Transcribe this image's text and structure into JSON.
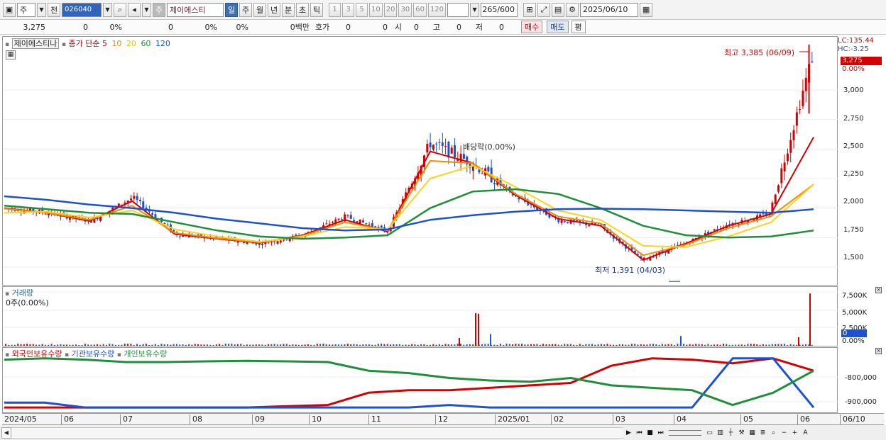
{
  "toolbar": {
    "market_type": "주",
    "prev_label": "전",
    "stock_code": "026040",
    "stock_badge": "주",
    "stock_name": "제이에스티",
    "periods": [
      "일",
      "주",
      "월",
      "년",
      "분",
      "초",
      "틱"
    ],
    "active_period": "일",
    "intervals": [
      "1",
      "3",
      "5",
      "10",
      "20",
      "30",
      "60",
      "120"
    ],
    "bar_count": "265",
    "bar_total": "/600",
    "date": "2025/06/10"
  },
  "quote": {
    "price": "3,275",
    "change": "0",
    "change_pct": "0%",
    "volume": "0",
    "volume_pct": "0%",
    "volume_pct2": "0%",
    "amount": "0백만",
    "hoga_label": "호가",
    "hoga_bid": "0",
    "hoga_ask": "0",
    "open_label": "시",
    "open_value": "0",
    "high_label": "고",
    "high_value": "0",
    "low_label": "저",
    "low_value": "0",
    "buy_label": "매수",
    "sell_label": "매도",
    "eval_label": "평"
  },
  "price_pane": {
    "stock_label": "제이에스티나",
    "ma_legend_title": "종가 단순",
    "ma_periods": [
      {
        "period": "5",
        "color": "#d40000"
      },
      {
        "period": "10",
        "color": "#f08c00"
      },
      {
        "period": "20",
        "color": "#ffd21a"
      },
      {
        "period": "60",
        "color": "#1f8f3a"
      },
      {
        "period": "120",
        "color": "#1e50d2"
      }
    ],
    "lc_label": "LC:135.44",
    "hc_label": "HC:-3.25",
    "current_price_tag": "3,275",
    "current_pct_tag": "0.00%",
    "y_ticks": [
      "3,000",
      "2,750",
      "2,500",
      "2,250",
      "2,000",
      "1,750",
      "1,500"
    ],
    "high_annotation": "최고 3,385 (06/09)",
    "low_annotation": "최저 1,391 (04/03)",
    "dividend_annotation": "배당락(0.00%)"
  },
  "volume_pane": {
    "title": "거래량",
    "subtitle": "0주(0.00%)",
    "y_ticks": [
      "7,500K",
      "5,000K",
      "2,500K"
    ],
    "current_tag": "0",
    "pct_tag": "0.00%"
  },
  "holdings_pane": {
    "series": [
      {
        "name": "외국인보유수량",
        "color": "#d40000"
      },
      {
        "name": "기관보유수량",
        "color": "#1e50d2"
      },
      {
        "name": "개인보유수량",
        "color": "#1f8f3a"
      }
    ],
    "y_ticks": [
      "-800,000",
      "-900,000"
    ]
  },
  "x_axis": {
    "labels": [
      "2024/05",
      "06",
      "07",
      "08",
      "09",
      "10",
      "11",
      "12",
      "2025/01",
      "02",
      "03",
      "04",
      "05",
      "06"
    ],
    "right_label": "06/10"
  },
  "colors": {
    "up": "#d40000",
    "down": "#1e50d2",
    "ma5": "#d40000",
    "ma10": "#f08c00",
    "ma20": "#ffd21a",
    "ma60": "#1f8f3a",
    "ma120": "#1e50d2",
    "accent": "#3265b8"
  },
  "chart_data": [
    {
      "type": "candlestick",
      "title": "제이에스티나",
      "y_axis": {
        "min": 1350,
        "max": 3450,
        "ticks": [
          3000,
          2750,
          2500,
          2250,
          2000,
          1750,
          1500
        ]
      },
      "x_categories": [
        "2024/05",
        "06",
        "07",
        "08",
        "09",
        "10",
        "11",
        "12",
        "2025/01",
        "02",
        "03",
        "04",
        "05",
        "06"
      ],
      "close_path": [
        [
          "2024/05",
          2000
        ],
        [
          "06",
          1960
        ],
        [
          "07",
          1890
        ],
        [
          "07b",
          2090
        ],
        [
          "08",
          1780
        ],
        [
          "09",
          1740
        ],
        [
          "10",
          1700
        ],
        [
          "11",
          1770
        ],
        [
          "11b",
          1930
        ],
        [
          "12",
          1800
        ],
        [
          "12b",
          2550
        ],
        [
          "2025/01",
          2380
        ],
        [
          "02",
          2100
        ],
        [
          "03",
          1900
        ],
        [
          "03b",
          1850
        ],
        [
          "04",
          1560
        ],
        [
          "05",
          1700
        ],
        [
          "05b",
          1860
        ],
        [
          "06",
          1950
        ],
        [
          "06b",
          3275
        ]
      ],
      "series": [
        {
          "name": "5",
          "values": [
            2000,
            1960,
            1890,
            2060,
            1780,
            1740,
            1705,
            1770,
            1900,
            1800,
            2480,
            2380,
            2110,
            1910,
            1850,
            1560,
            1700,
            1850,
            1950,
            2600
          ]
        },
        {
          "name": "10",
          "values": [
            1995,
            1960,
            1900,
            2020,
            1790,
            1745,
            1710,
            1765,
            1880,
            1810,
            2400,
            2380,
            2120,
            1930,
            1870,
            1600,
            1690,
            1830,
            1930,
            2200
          ]
        },
        {
          "name": "20",
          "values": [
            1960,
            1970,
            1920,
            1980,
            1820,
            1760,
            1715,
            1760,
            1840,
            1820,
            2250,
            2360,
            2180,
            1980,
            1900,
            1680,
            1670,
            1760,
            1880,
            2200
          ]
        },
        {
          "name": "60",
          "values": [
            2020,
            1990,
            1960,
            1950,
            1880,
            1810,
            1760,
            1740,
            1750,
            1770,
            2000,
            2140,
            2160,
            2120,
            2000,
            1850,
            1770,
            1750,
            1760,
            1810
          ]
        },
        {
          "name": "120",
          "values": [
            2100,
            2070,
            2030,
            2000,
            1960,
            1910,
            1870,
            1830,
            1810,
            1820,
            1900,
            1940,
            1970,
            1990,
            1995,
            1990,
            1980,
            1970,
            1960,
            1990
          ]
        }
      ],
      "annotations": [
        {
          "label": "최고 3,385 (06/09)",
          "x": "06/09",
          "y": 3385
        },
        {
          "label": "최저 1,391 (04/03)",
          "x": "04/03",
          "y": 1391
        }
      ]
    },
    {
      "type": "bar",
      "title": "거래량",
      "y_axis": {
        "min": 0,
        "max": 9000000,
        "ticks": [
          7500000,
          5000000,
          2500000
        ]
      },
      "bars": [
        {
          "x": "12",
          "value": 1200000,
          "up": true
        },
        {
          "x": "12",
          "value": 5000000,
          "up": true
        },
        {
          "x": "12",
          "value": 4900000,
          "up": true
        },
        {
          "x": "12",
          "value": 1800000,
          "up": false
        },
        {
          "x": "04",
          "value": 1500000,
          "up": false
        },
        {
          "x": "06",
          "value": 1300000,
          "up": true
        },
        {
          "x": "06",
          "value": 8000000,
          "up": true
        }
      ]
    },
    {
      "type": "line",
      "title": "보유수량",
      "y_axis": {
        "min": -960000,
        "max": -700000,
        "ticks": [
          -800000,
          -900000
        ]
      },
      "series": [
        {
          "name": "외국인보유수량",
          "values": [
            -940000,
            -940000,
            -940000,
            -940000,
            -940000,
            -940000,
            -940000,
            -935000,
            -930000,
            -880000,
            -870000,
            -870000,
            -860000,
            -850000,
            -840000,
            -770000,
            -740000,
            -745000,
            -760000,
            -740000,
            -790000
          ]
        },
        {
          "name": "기관보유수량",
          "values": [
            -920000,
            -920000,
            -940000,
            -940000,
            -940000,
            -940000,
            -940000,
            -940000,
            -940000,
            -940000,
            -940000,
            -930000,
            -940000,
            -940000,
            -940000,
            -940000,
            -940000,
            -940000,
            -740000,
            -740000,
            -940000
          ]
        },
        {
          "name": "개인보유수량",
          "values": [
            -745000,
            -740000,
            -745000,
            -755000,
            -755000,
            -752000,
            -750000,
            -752000,
            -755000,
            -790000,
            -800000,
            -820000,
            -830000,
            -835000,
            -820000,
            -850000,
            -860000,
            -870000,
            -930000,
            -880000,
            -790000
          ]
        }
      ]
    }
  ]
}
